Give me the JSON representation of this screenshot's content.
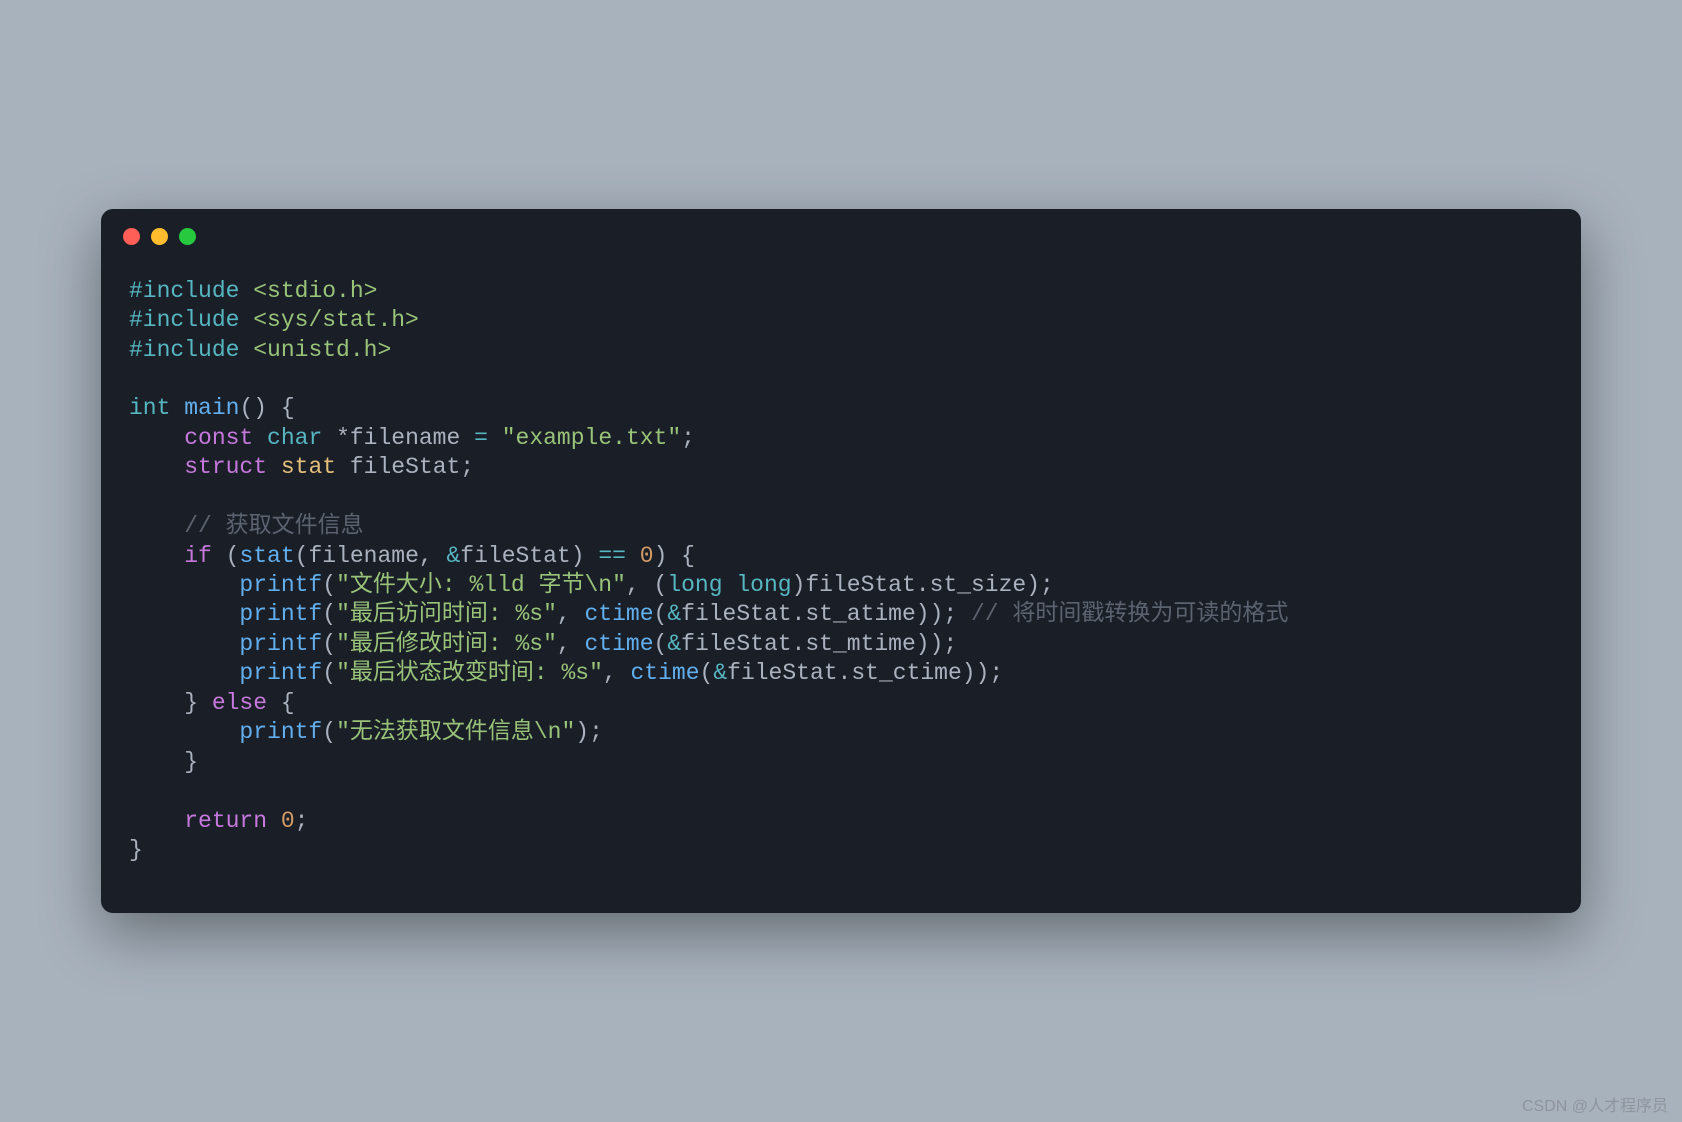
{
  "colors": {
    "bg": "#a8b2bd",
    "windowBg": "#1a1e26",
    "red": "#ff5f56",
    "yellow": "#ffbd2e",
    "green": "#27c93f",
    "keyword": "#c678dd",
    "type": "#56b6c2",
    "function": "#61afef",
    "string": "#98c379",
    "number": "#d19a66",
    "comment": "#5c6370",
    "default": "#abb2bf"
  },
  "code": {
    "tokens": [
      [
        {
          "t": "#include",
          "c": "kw-preproc"
        },
        {
          "t": " ",
          "c": ""
        },
        {
          "t": "<stdio.h>",
          "c": "str"
        }
      ],
      [
        {
          "t": "#include",
          "c": "kw-preproc"
        },
        {
          "t": " ",
          "c": ""
        },
        {
          "t": "<sys/stat.h>",
          "c": "str"
        }
      ],
      [
        {
          "t": "#include",
          "c": "kw-preproc"
        },
        {
          "t": " ",
          "c": ""
        },
        {
          "t": "<unistd.h>",
          "c": "str"
        }
      ],
      [],
      [
        {
          "t": "int",
          "c": "kw-type"
        },
        {
          "t": " ",
          "c": ""
        },
        {
          "t": "main",
          "c": "fn"
        },
        {
          "t": "() {",
          "c": "paren"
        }
      ],
      [
        {
          "t": "    ",
          "c": ""
        },
        {
          "t": "const",
          "c": "kw-ctrl"
        },
        {
          "t": " ",
          "c": ""
        },
        {
          "t": "char",
          "c": "kw-type"
        },
        {
          "t": " *filename ",
          "c": "ident2"
        },
        {
          "t": "=",
          "c": "op"
        },
        {
          "t": " ",
          "c": ""
        },
        {
          "t": "\"example.txt\"",
          "c": "str"
        },
        {
          "t": ";",
          "c": "paren"
        }
      ],
      [
        {
          "t": "    ",
          "c": ""
        },
        {
          "t": "struct",
          "c": "kw-ctrl"
        },
        {
          "t": " ",
          "c": ""
        },
        {
          "t": "stat",
          "c": "ident"
        },
        {
          "t": " fileStat;",
          "c": "ident2"
        }
      ],
      [],
      [
        {
          "t": "    ",
          "c": ""
        },
        {
          "t": "// 获取文件信息",
          "c": "comment"
        }
      ],
      [
        {
          "t": "    ",
          "c": ""
        },
        {
          "t": "if",
          "c": "kw-ctrl"
        },
        {
          "t": " (",
          "c": "paren"
        },
        {
          "t": "stat",
          "c": "fn"
        },
        {
          "t": "(filename, ",
          "c": "ident2"
        },
        {
          "t": "&",
          "c": "op"
        },
        {
          "t": "fileStat) ",
          "c": "ident2"
        },
        {
          "t": "==",
          "c": "op"
        },
        {
          "t": " ",
          "c": ""
        },
        {
          "t": "0",
          "c": "num"
        },
        {
          "t": ") {",
          "c": "paren"
        }
      ],
      [
        {
          "t": "        ",
          "c": ""
        },
        {
          "t": "printf",
          "c": "fn"
        },
        {
          "t": "(",
          "c": "paren"
        },
        {
          "t": "\"文件大小: %lld 字节\\n\"",
          "c": "str"
        },
        {
          "t": ", (",
          "c": "paren"
        },
        {
          "t": "long",
          "c": "kw-type"
        },
        {
          "t": " ",
          "c": ""
        },
        {
          "t": "long",
          "c": "kw-type"
        },
        {
          "t": ")fileStat.st_size);",
          "c": "ident2"
        }
      ],
      [
        {
          "t": "        ",
          "c": ""
        },
        {
          "t": "printf",
          "c": "fn"
        },
        {
          "t": "(",
          "c": "paren"
        },
        {
          "t": "\"最后访问时间: %s\"",
          "c": "str"
        },
        {
          "t": ", ",
          "c": "paren"
        },
        {
          "t": "ctime",
          "c": "fn"
        },
        {
          "t": "(",
          "c": "paren"
        },
        {
          "t": "&",
          "c": "op"
        },
        {
          "t": "fileStat.st_atime)); ",
          "c": "ident2"
        },
        {
          "t": "// 将时间戳转换为可读的格式",
          "c": "comment"
        }
      ],
      [
        {
          "t": "        ",
          "c": ""
        },
        {
          "t": "printf",
          "c": "fn"
        },
        {
          "t": "(",
          "c": "paren"
        },
        {
          "t": "\"最后修改时间: %s\"",
          "c": "str"
        },
        {
          "t": ", ",
          "c": "paren"
        },
        {
          "t": "ctime",
          "c": "fn"
        },
        {
          "t": "(",
          "c": "paren"
        },
        {
          "t": "&",
          "c": "op"
        },
        {
          "t": "fileStat.st_mtime));",
          "c": "ident2"
        }
      ],
      [
        {
          "t": "        ",
          "c": ""
        },
        {
          "t": "printf",
          "c": "fn"
        },
        {
          "t": "(",
          "c": "paren"
        },
        {
          "t": "\"最后状态改变时间: %s\"",
          "c": "str"
        },
        {
          "t": ", ",
          "c": "paren"
        },
        {
          "t": "ctime",
          "c": "fn"
        },
        {
          "t": "(",
          "c": "paren"
        },
        {
          "t": "&",
          "c": "op"
        },
        {
          "t": "fileStat.st_ctime));",
          "c": "ident2"
        }
      ],
      [
        {
          "t": "    } ",
          "c": "paren"
        },
        {
          "t": "else",
          "c": "kw-ctrl"
        },
        {
          "t": " {",
          "c": "paren"
        }
      ],
      [
        {
          "t": "        ",
          "c": ""
        },
        {
          "t": "printf",
          "c": "fn"
        },
        {
          "t": "(",
          "c": "paren"
        },
        {
          "t": "\"无法获取文件信息\\n\"",
          "c": "str"
        },
        {
          "t": ");",
          "c": "paren"
        }
      ],
      [
        {
          "t": "    }",
          "c": "paren"
        }
      ],
      [],
      [
        {
          "t": "    ",
          "c": ""
        },
        {
          "t": "return",
          "c": "kw-ctrl"
        },
        {
          "t": " ",
          "c": ""
        },
        {
          "t": "0",
          "c": "num"
        },
        {
          "t": ";",
          "c": "paren"
        }
      ],
      [
        {
          "t": "}",
          "c": "paren"
        }
      ]
    ]
  },
  "watermark": "CSDN @人才程序员"
}
